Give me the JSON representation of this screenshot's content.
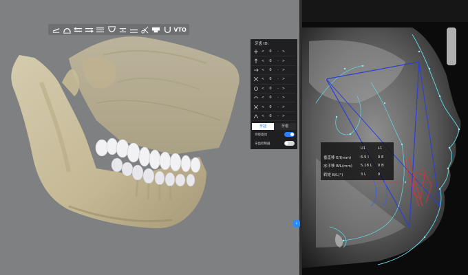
{
  "toolbar": {
    "icons": [
      "tilt-left-icon",
      "arch-view-icon",
      "lateral-left-icon",
      "lateral-right-icon",
      "occlusion-icon",
      "lower-arch-icon",
      "overjet-icon",
      "midline-icon",
      "scissors-icon",
      "display-mode-icon",
      "u-arch-icon"
    ],
    "vto_label": "VTO"
  },
  "tooth_panel": {
    "title": "牙齿 ID:",
    "rows": [
      {
        "icon": "move-mesiodistal-icon",
        "left": "<",
        "value": "0",
        "sep": "-",
        "right": ">"
      },
      {
        "icon": "move-buccolingual-icon",
        "left": "<",
        "value": "0",
        "sep": "-",
        "right": ">"
      },
      {
        "icon": "move-vertical-icon",
        "left": "<",
        "value": "0",
        "sep": "-",
        "right": ">"
      },
      {
        "icon": "move-diagonal-icon",
        "left": "<",
        "value": "0",
        "sep": "-",
        "right": ">"
      },
      {
        "icon": "rotate-icon",
        "left": "<",
        "value": "0",
        "sep": "-",
        "right": ">"
      },
      {
        "icon": "tip-icon",
        "left": "<",
        "value": "0",
        "sep": "-",
        "right": ">"
      },
      {
        "icon": "torque-icon",
        "left": "<",
        "value": "0",
        "sep": "-",
        "right": ">"
      },
      {
        "icon": "angulation-icon",
        "left": "<",
        "value": "0",
        "sep": "-",
        "right": ">"
      }
    ],
    "tabs": [
      {
        "label": "牙冠",
        "active": true
      },
      {
        "label": "牙根",
        "active": false
      }
    ],
    "toggles": [
      {
        "label": "邻接驱动",
        "on": true
      },
      {
        "label": "牙齿控制器",
        "on": false
      }
    ]
  },
  "collapse_button": "›",
  "ceph_table": {
    "headers": [
      "",
      "U1",
      "L1"
    ],
    "rows": [
      {
        "label": "垂直移 E/I(mm)",
        "u1": "6.5 I",
        "l1": "0 E"
      },
      {
        "label": "水平移 B/L(mm)",
        "u1": "5.18 L",
        "l1": "0 B"
      },
      {
        "label": "转矩 B/L(°)",
        "u1": "3 L",
        "l1": "0"
      }
    ]
  }
}
